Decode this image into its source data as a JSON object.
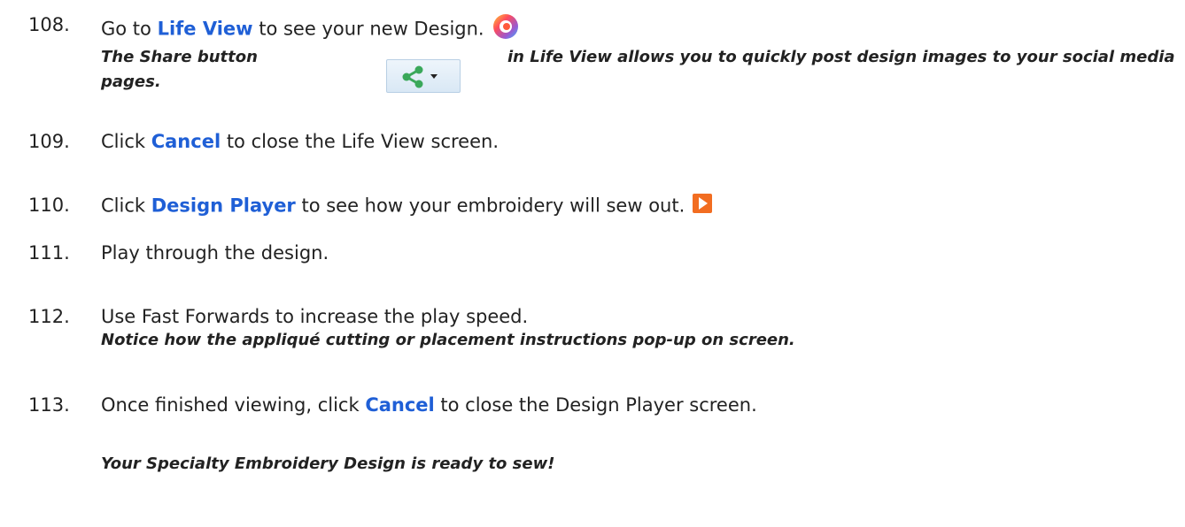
{
  "steps": [
    {
      "number": "108.",
      "pre": "Go to ",
      "keyword": "Life View",
      "post": " to see your new Design."
    },
    {
      "number": "109.",
      "pre": "Click ",
      "keyword": "Cancel",
      "post": " to close the Life View screen."
    },
    {
      "number": "110.",
      "pre": "Click ",
      "keyword": "Design Player",
      "post": " to see how your embroidery will sew out."
    },
    {
      "number": "111.",
      "text": "Play through the design."
    },
    {
      "number": "112.",
      "text": "Use Fast Forwards to increase the play speed."
    },
    {
      "number": "113.",
      "pre": "Once finished viewing, click ",
      "keyword": "Cancel",
      "post": " to close the Design Player screen."
    }
  ],
  "notes": {
    "share_pre": "The Share button",
    "share_post": "in Life View allows you to quickly post design images to your social media",
    "share_cont": "pages.",
    "applique": "Notice how the appliqué cutting or placement instructions pop-up on screen.",
    "final": "Your Specialty Embroidery Design is ready to sew!"
  },
  "icons": {
    "life_view": "life-view-icon",
    "share": "share-icon",
    "design_player": "play-icon"
  },
  "colors": {
    "keyword": "#1f5fd6",
    "play_icon": "#f26d21"
  }
}
